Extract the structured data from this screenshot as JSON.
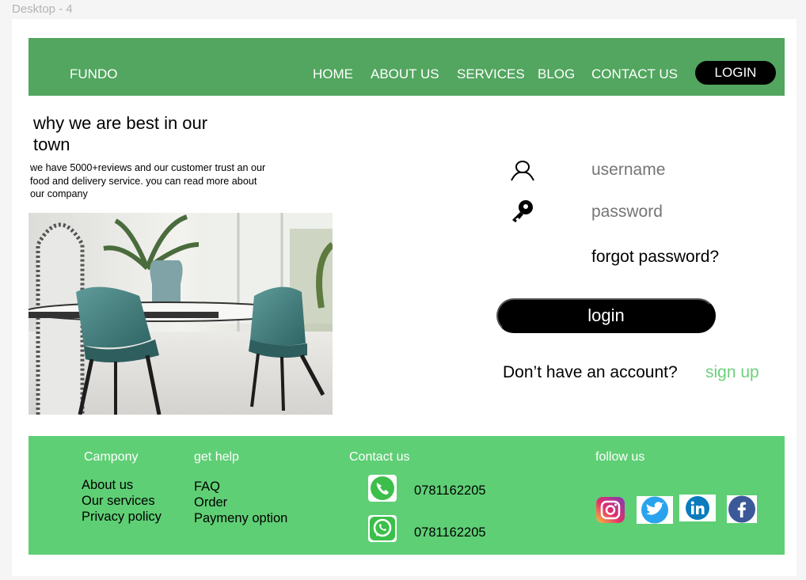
{
  "frame_label": "Desktop - 4",
  "header": {
    "brand": "FUNDO",
    "nav": [
      "HOME",
      "ABOUT US",
      "SERVICES",
      "BLOG",
      "CONTACT US"
    ],
    "login_label": "LOGIN"
  },
  "hero": {
    "title": "why we are best in our town",
    "text": "we have 5000+reviews and our customer trust an our food and delivery service. you can read more about our company"
  },
  "form": {
    "username_placeholder": "username",
    "password_placeholder": "password",
    "forgot": "forgot password?",
    "login_label": "login",
    "no_account": "Don’t have an account?",
    "signup": "sign up"
  },
  "footer": {
    "company": {
      "heading": "Campony",
      "items": [
        "About us",
        "Our services",
        "Privacy policy"
      ]
    },
    "help": {
      "heading": "get help",
      "items": [
        "FAQ",
        "Order",
        "Paymeny option"
      ]
    },
    "contact": {
      "heading": "Contact us",
      "phone": "0781162205",
      "whatsapp": "0781162205"
    },
    "follow": {
      "heading": "follow us",
      "icons": [
        "instagram-icon",
        "twitter-icon",
        "linkedin-icon",
        "facebook-icon"
      ]
    }
  },
  "colors": {
    "header_green": "#52a65f",
    "footer_green": "#5fcf75",
    "signup_green": "#6ed07a"
  }
}
